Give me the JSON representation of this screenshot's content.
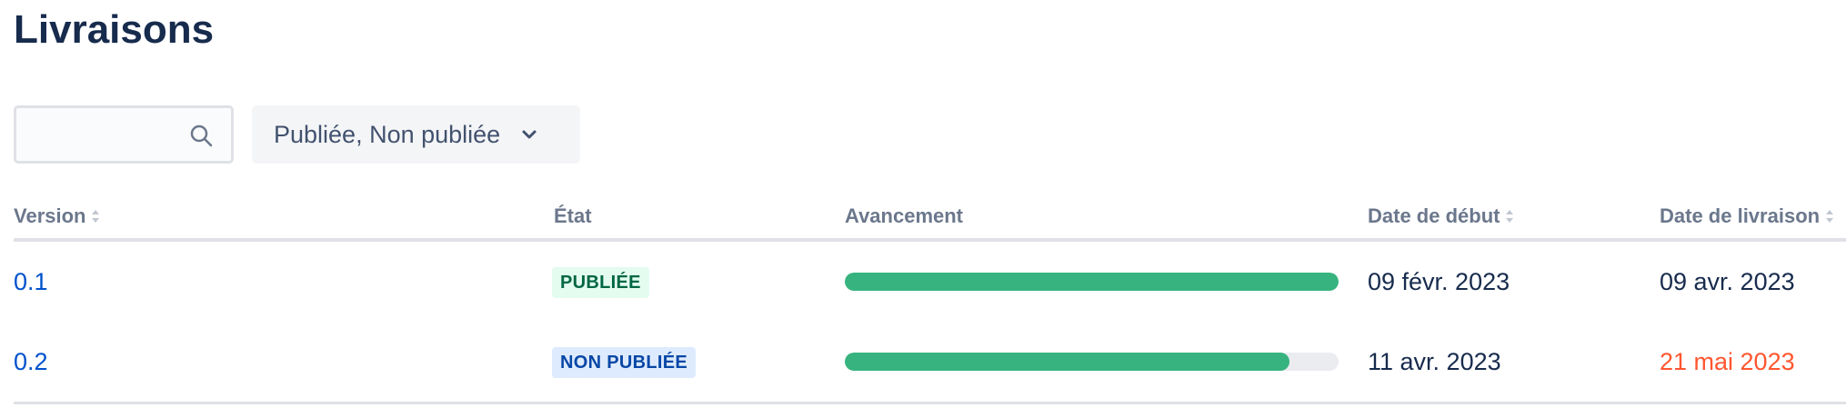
{
  "page": {
    "title": "Livraisons"
  },
  "filters": {
    "search_placeholder": "",
    "status_label": "Publiée, Non publiée"
  },
  "table": {
    "columns": {
      "version": "Version",
      "state": "État",
      "progress": "Avancement",
      "start_date": "Date de début",
      "release_date": "Date de livraison"
    },
    "rows": [
      {
        "version": "0.1",
        "state": "PUBLIÉE",
        "state_kind": "released",
        "progress": 1.0,
        "start_date": "09 févr. 2023",
        "release_date": "09 avr. 2023",
        "release_overdue": false
      },
      {
        "version": "0.2",
        "state": "NON PUBLIÉE",
        "state_kind": "unreleased",
        "progress": 0.9,
        "start_date": "11 avr. 2023",
        "release_date": "21 mai 2023",
        "release_overdue": true
      }
    ]
  },
  "colors": {
    "progress_fill": "#36b37e",
    "progress_track": "#ebecf0",
    "link": "#0052cc",
    "overdue": "#ff5630"
  }
}
